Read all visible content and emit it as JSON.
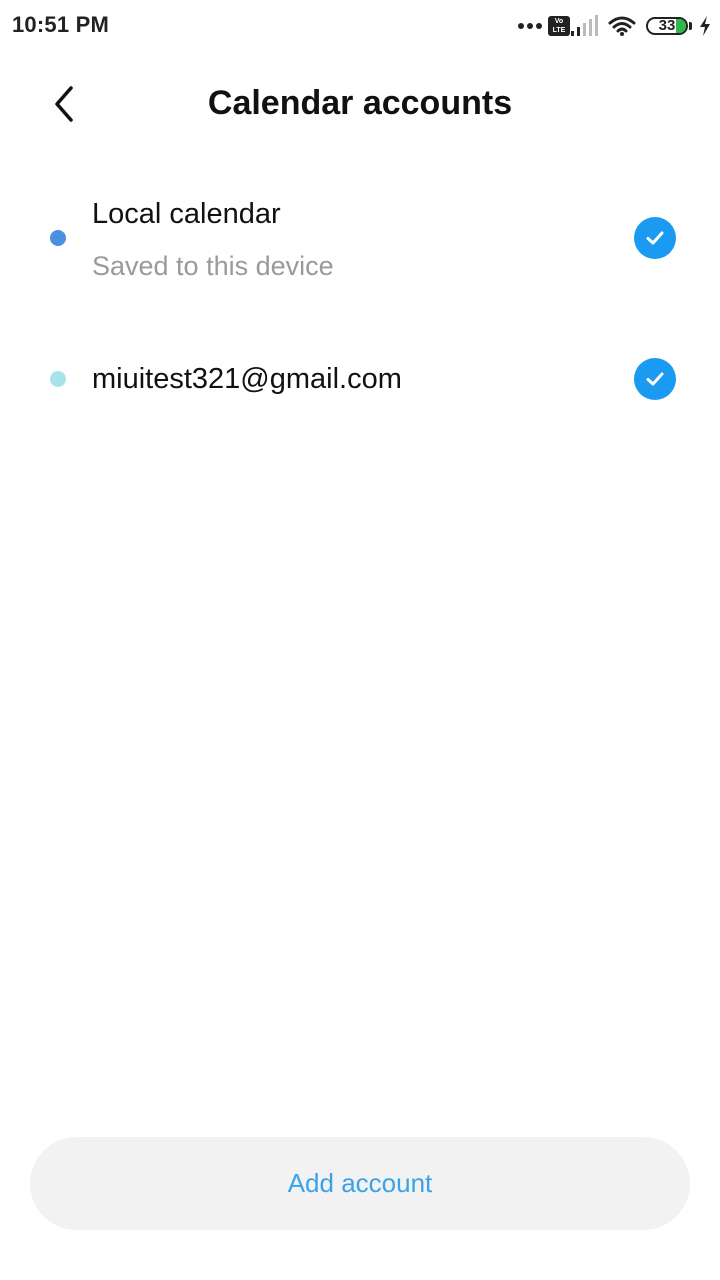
{
  "status_bar": {
    "time": "10:51 PM",
    "volte_top": "Vo",
    "volte_bottom": "LTE",
    "battery_level": "33",
    "icons": [
      "more-dots-icon",
      "volte-icon",
      "signal-icon",
      "wifi-icon",
      "battery-icon",
      "charging-bolt-icon"
    ]
  },
  "header": {
    "title": "Calendar accounts",
    "back_icon": "chevron-left-icon"
  },
  "accounts": [
    {
      "name": "Local calendar",
      "subtitle": "Saved to this device",
      "dot_color": "#4a90e2",
      "checked": true
    },
    {
      "name": "miuitest321@gmail.com",
      "subtitle": "",
      "dot_color": "#a8e2ea",
      "checked": true
    }
  ],
  "footer": {
    "add_account_label": "Add account"
  },
  "colors": {
    "accent": "#1a9af0",
    "link_text": "#3aa3e8",
    "button_bg": "#f2f2f2"
  }
}
